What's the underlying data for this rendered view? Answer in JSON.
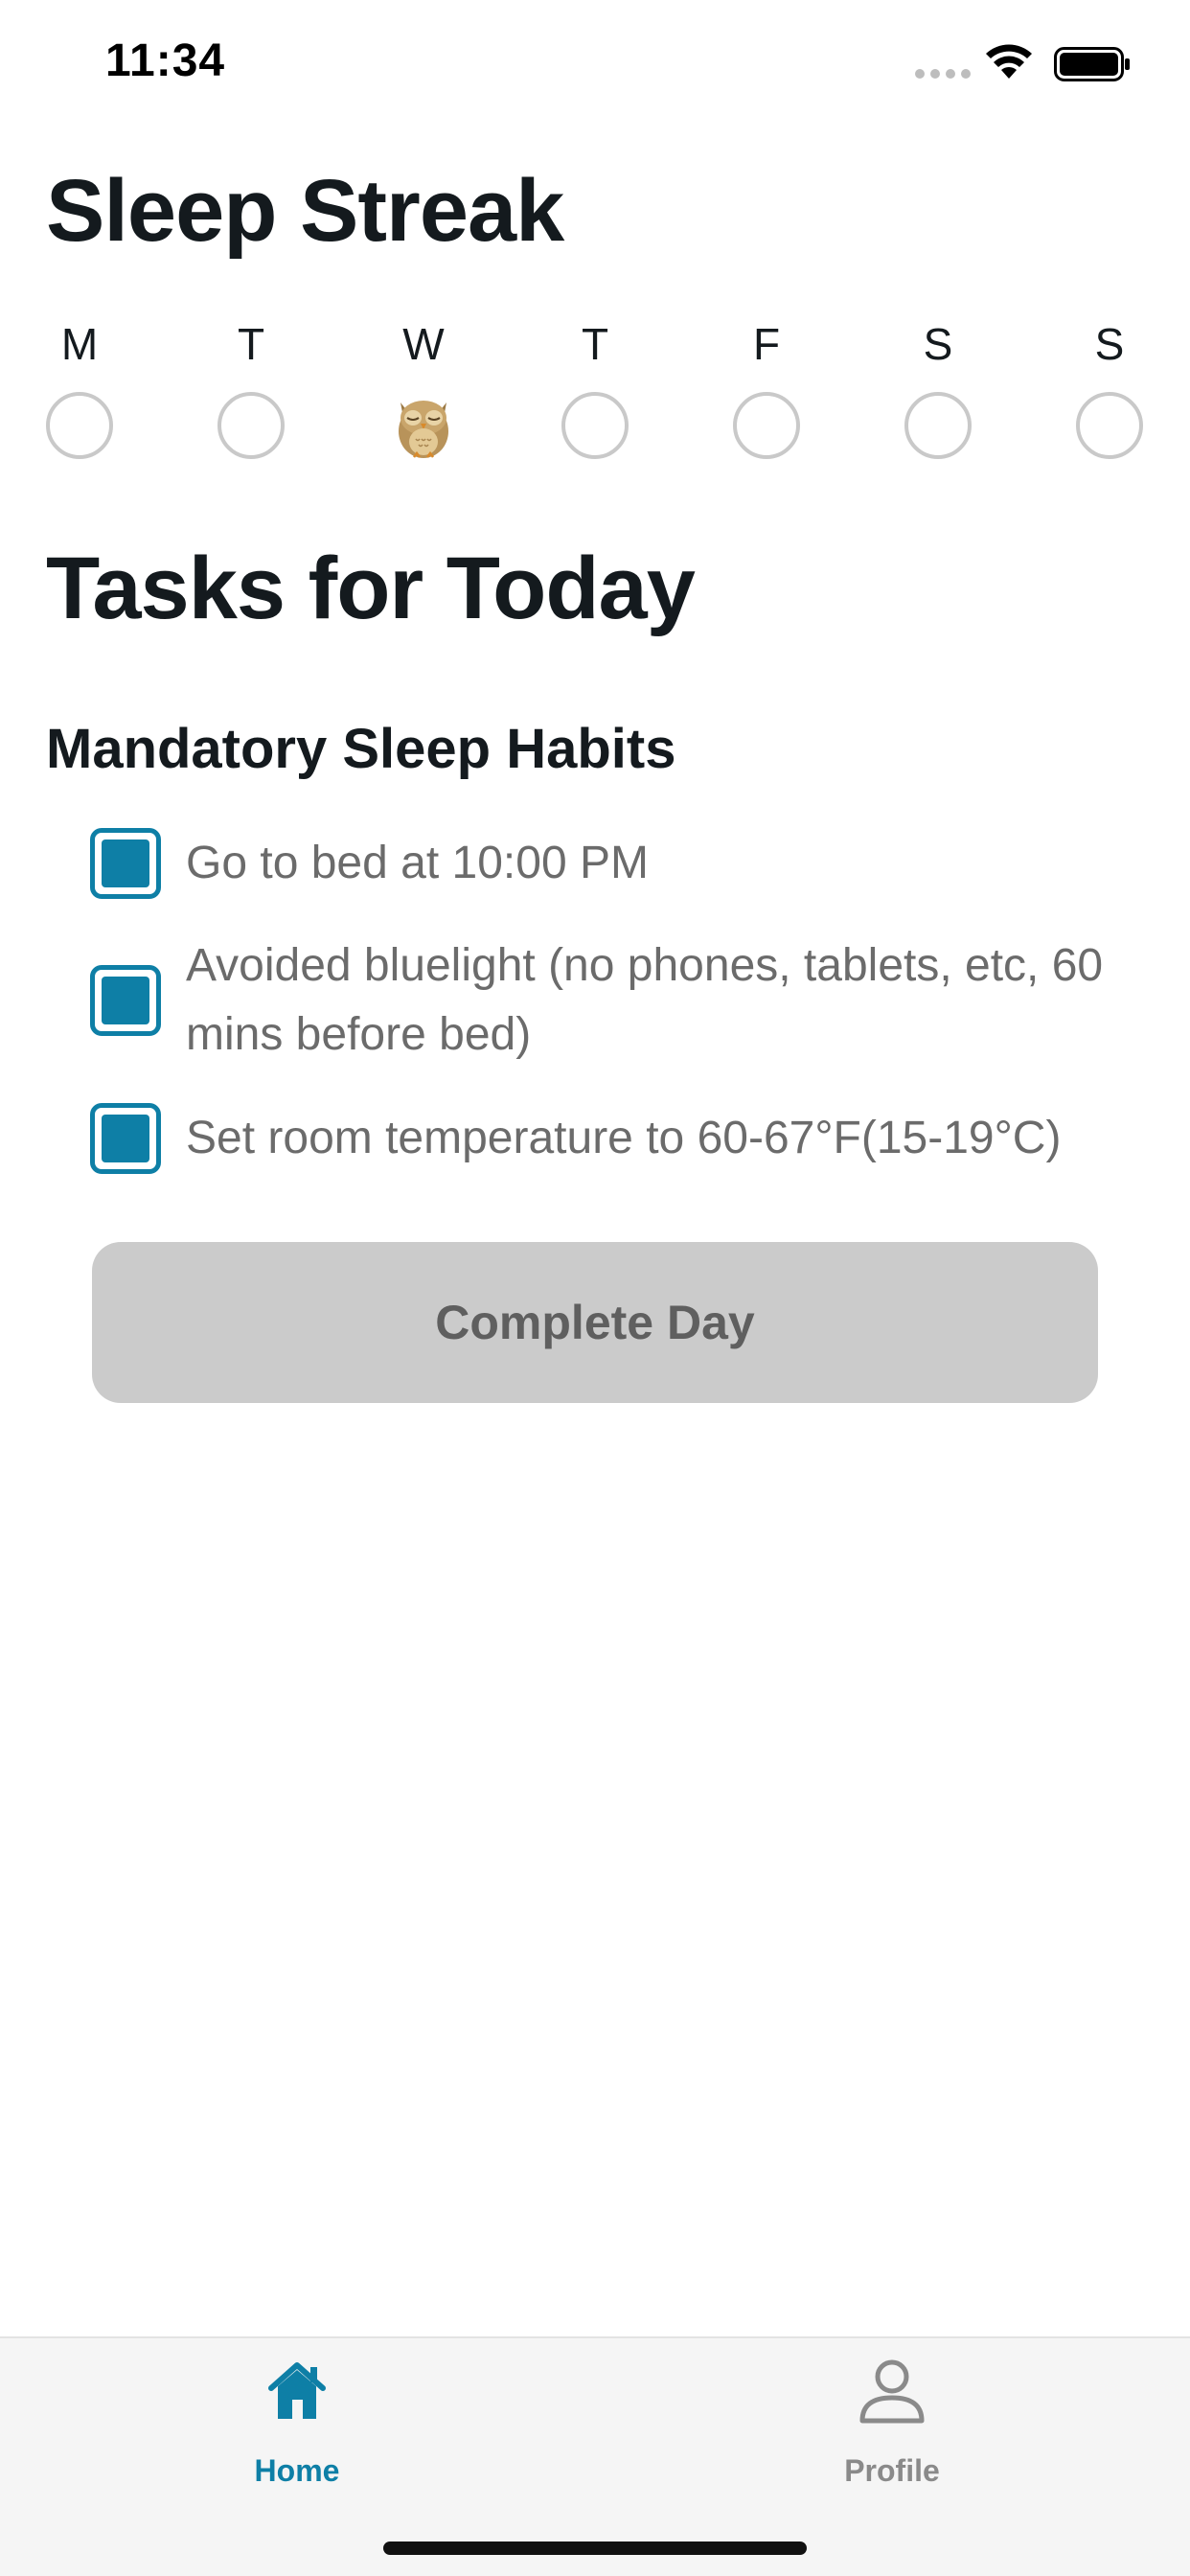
{
  "status_bar": {
    "time": "11:34"
  },
  "streak": {
    "title": "Sleep Streak",
    "days": [
      {
        "label": "M",
        "state": "empty"
      },
      {
        "label": "T",
        "state": "empty"
      },
      {
        "label": "W",
        "state": "owl"
      },
      {
        "label": "T",
        "state": "empty"
      },
      {
        "label": "F",
        "state": "empty"
      },
      {
        "label": "S",
        "state": "empty"
      },
      {
        "label": "S",
        "state": "empty"
      }
    ],
    "marker_icon": "owl-icon"
  },
  "tasks": {
    "title": "Tasks for Today",
    "section_title": "Mandatory Sleep Habits",
    "items": [
      {
        "text": "Go to bed at 10:00 PM",
        "checked": true
      },
      {
        "text": "Avoided bluelight (no phones, tablets, etc, 60 mins before bed)",
        "checked": true
      },
      {
        "text": "Set room temperature to 60-67°F(15-19°C)",
        "checked": true
      }
    ],
    "complete_label": "Complete Day"
  },
  "tab_bar": {
    "home_label": "Home",
    "profile_label": "Profile",
    "active": "home"
  },
  "colors": {
    "accent": "#0e7fa6",
    "button_disabled_bg": "#cbcbcb",
    "task_text": "#6b6b6b"
  }
}
